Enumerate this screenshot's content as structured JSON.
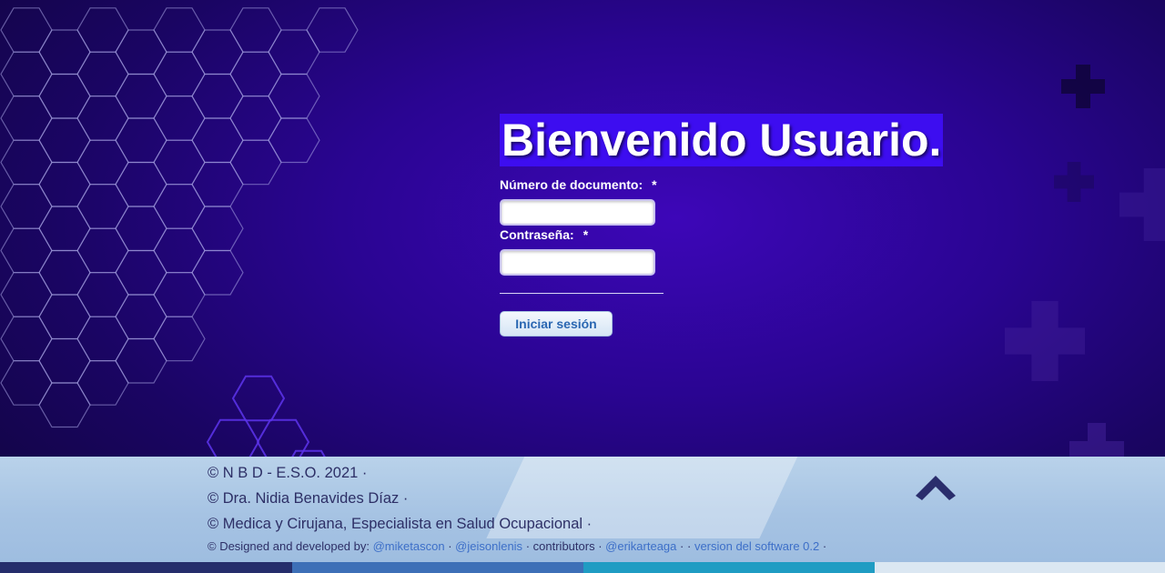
{
  "login": {
    "title": "Bienvenido Usuario.",
    "document_label": "Número de documento:",
    "password_label": "Contraseña:",
    "required_mark": "*",
    "document_value": "",
    "password_value": "",
    "submit_label": "Iniciar sesión"
  },
  "footer": {
    "line1": "© N B D - E.S.O. 2021 ·",
    "line2": "© Dra. Nidia Benavides Díaz ·",
    "line3": "© Medica y Cirujana, Especialista en Salud Ocupacional ·",
    "credits_prefix": "© Designed and developed by:",
    "dev1": "@miketascon",
    "sep": "·",
    "dev2": "@jeisonlenis",
    "contributors_label": "contributors ·",
    "contrib1": "@erikarteaga",
    "sep2": "· ·",
    "version": "version del software 0.2",
    "sep3": "·"
  },
  "icons": {
    "back_to_top": "chevron-up-icon"
  },
  "colors": {
    "background": "#2a0592",
    "title_highlight": "#3d0df0",
    "footer": "#a6c3e3",
    "strip": [
      "#252d6b",
      "#3d6fb7",
      "#1f9cc3",
      "#dbe7f2"
    ]
  }
}
